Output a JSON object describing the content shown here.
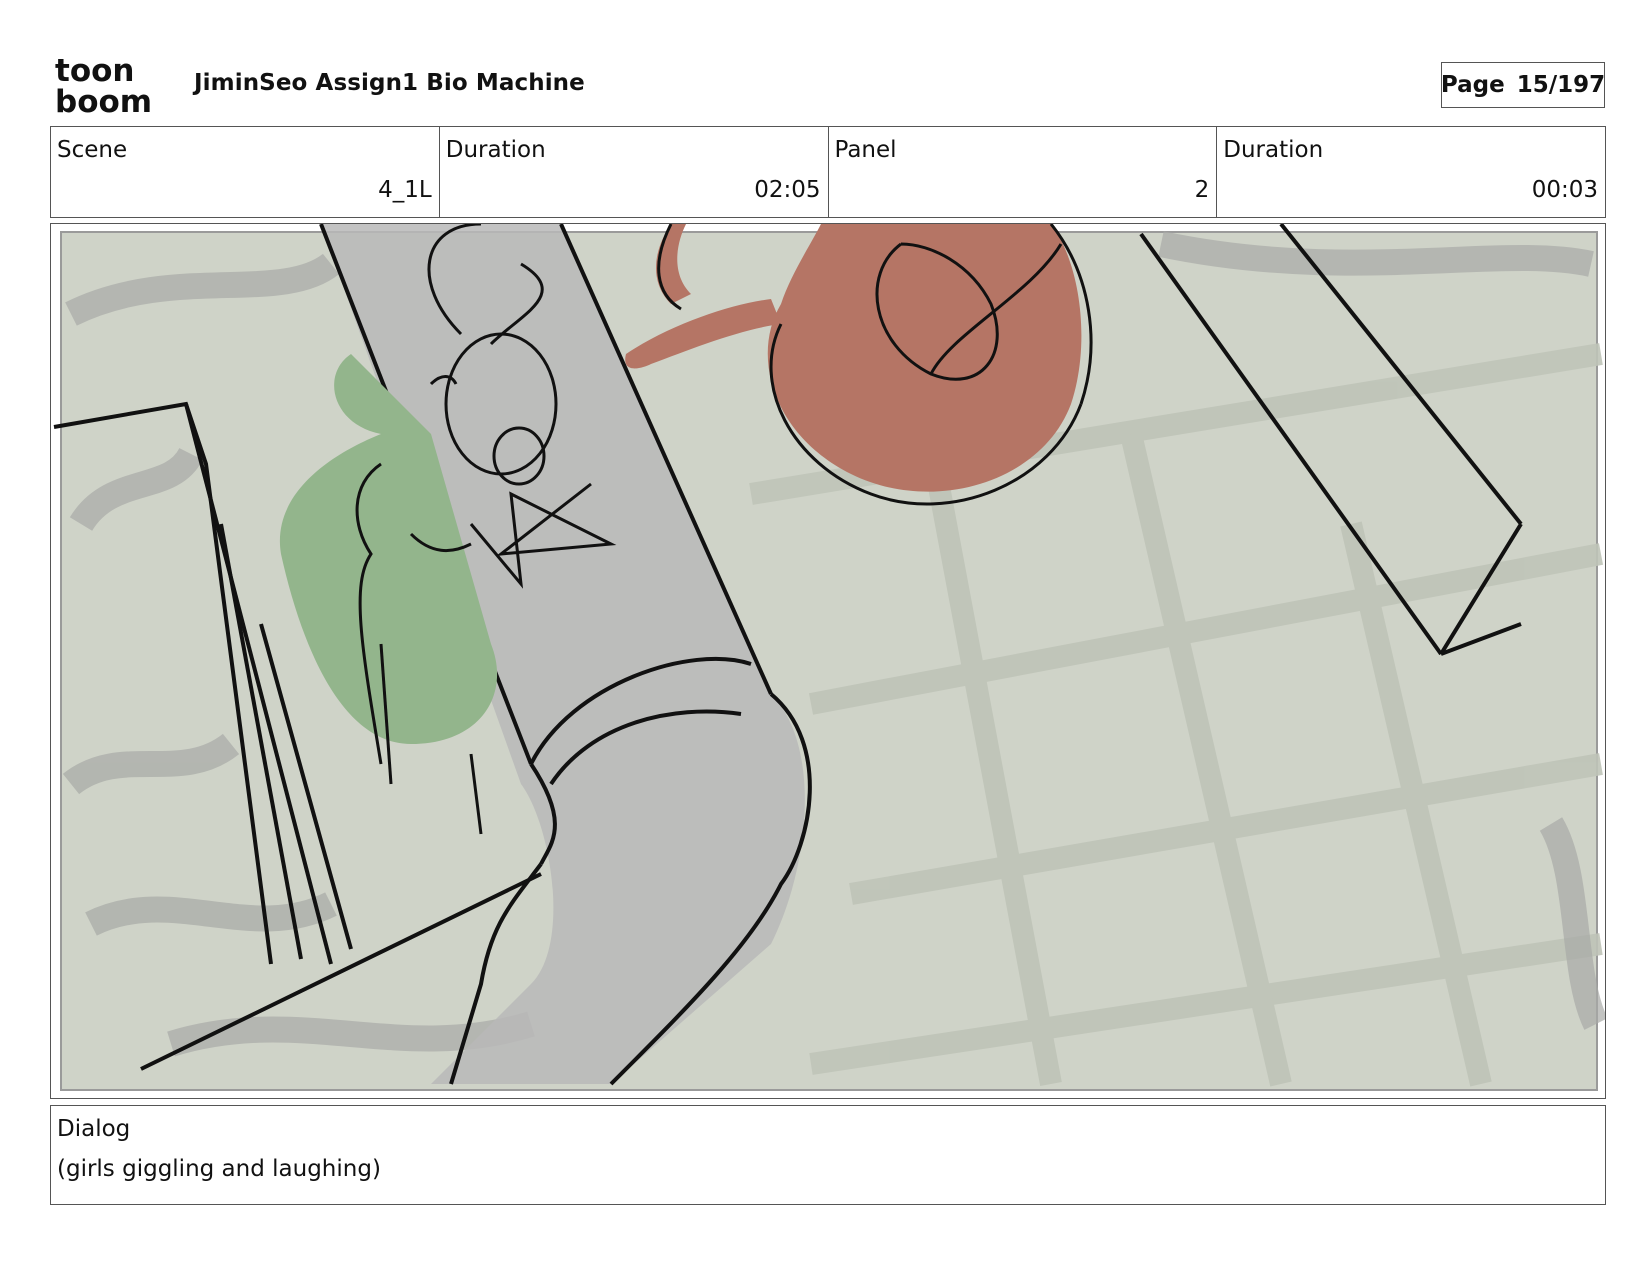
{
  "header": {
    "logo_top": "toon",
    "logo_bottom": "boom",
    "project_title": "JiminSeo Assign1 Bio Machine",
    "page_label": "Page",
    "page_value": "15/197"
  },
  "info": {
    "scene_label": "Scene",
    "scene_value": "4_1L",
    "scene_duration_label": "Duration",
    "scene_duration_value": "02:05",
    "panel_label": "Panel",
    "panel_value": "2",
    "panel_duration_label": "Duration",
    "panel_duration_value": "00:03"
  },
  "dialog": {
    "label": "Dialog",
    "text": "(girls giggling and laughing)"
  },
  "colors": {
    "background_sketch": "#cfd3c8",
    "green_character": "#93b58c",
    "red_character": "#b57565",
    "tube_gray": "#b9b9b9",
    "line": "#111111"
  }
}
